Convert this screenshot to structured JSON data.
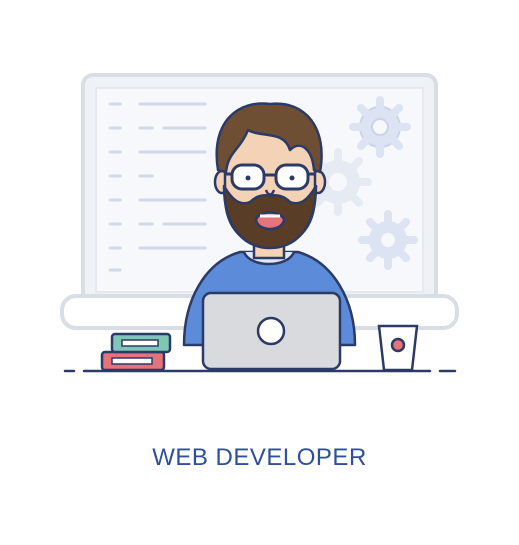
{
  "caption": "WEB DEVELOPER",
  "icons": [
    "monitor-icon",
    "code-lines-icon",
    "gear-icon",
    "developer-avatar-icon",
    "glasses-icon",
    "beard-icon",
    "laptop-icon",
    "books-icon",
    "cup-icon"
  ],
  "colors": {
    "outline": "#2b3a67",
    "accent_blue": "#5b8bd9",
    "light_blue": "#dfe8f8",
    "screen_bg": "#eef2fa",
    "monitor_frame": "#dfe3eb",
    "hair": "#6e4f33",
    "beard": "#5a3d26",
    "skin": "#f3d2b5",
    "laptop_gray": "#d8dadd",
    "book_red": "#e4737a",
    "book_teal": "#7fc6b9",
    "cup_red": "#e4737a",
    "caption": "#2f4f9c"
  }
}
